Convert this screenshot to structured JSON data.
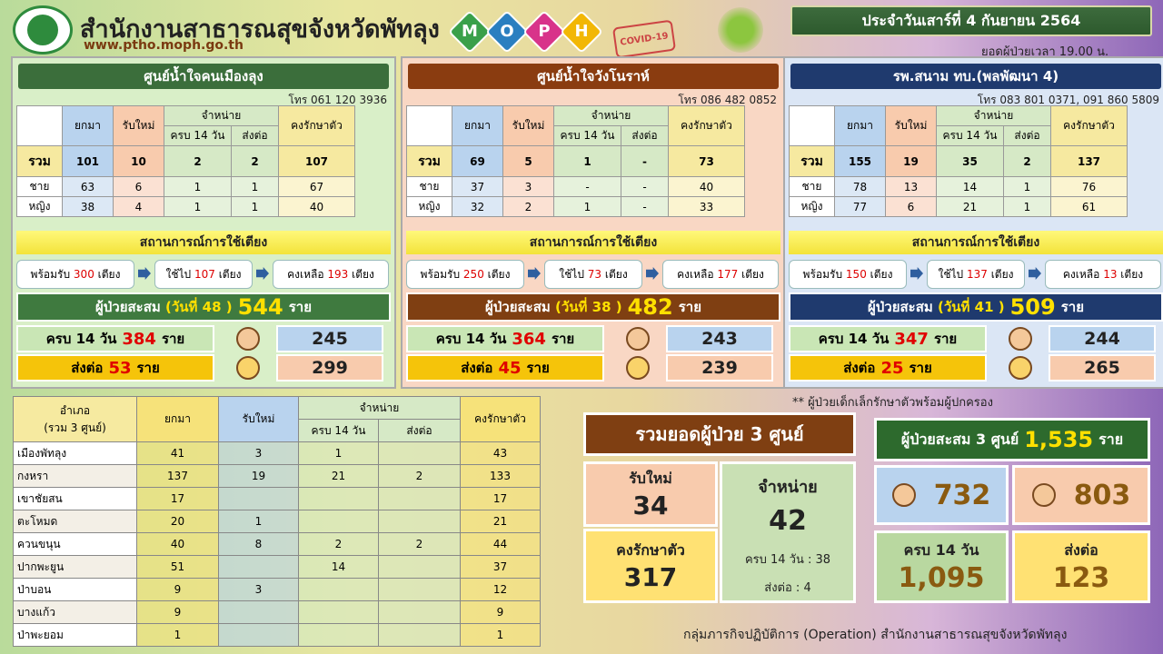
{
  "header": {
    "org": "สำนักงานสาธารณสุขจังหวัดพัทลุง",
    "web": "www.ptho.moph.go.th",
    "moph": [
      "M",
      "O",
      "P",
      "H"
    ],
    "covid_stamp": "COVID-19",
    "date": "ประจำวันเสาร์ที่ 4 กันยายน 2564",
    "as_of": "ยอดผู้ป่วยเวลา 19.00 น."
  },
  "cols": {
    "carry": "ยกมา",
    "new": "รับใหม่",
    "discharge": "จำหน่าย",
    "full14": "ครบ 14 วัน",
    "refer": "ส่งต่อ",
    "remain": "คงรักษาตัว",
    "total": "รวม",
    "male": "ชาย",
    "female": "หญิง"
  },
  "bed_title": "สถานการณ์การใช้เตียง",
  "centers": [
    {
      "title": "ศูนย์น้ำใจคนเมืองลุง",
      "phone": "โทร 061 120 3936",
      "total": [
        "101",
        "10",
        "2",
        "2",
        "107"
      ],
      "male": [
        "63",
        "6",
        "1",
        "1",
        "67"
      ],
      "female": [
        "38",
        "4",
        "1",
        "1",
        "40"
      ],
      "beds": [
        "พร้อมรับ",
        "300",
        "เตียง",
        "ใช้ไป",
        "107",
        "เตียง",
        "คงเหลือ",
        "193",
        "เตียง"
      ],
      "cum_label": "ผู้ป่วยสะสม",
      "cum_day": "(วันที่ 48 )",
      "cum_n": "544",
      "unit": "ราย",
      "full14": "384",
      "refer": "53",
      "boys": "245",
      "girls": "299"
    },
    {
      "title": "ศูนย์น้ำใจวังโนราห์",
      "phone": "โทร 086 482 0852",
      "total": [
        "69",
        "5",
        "1",
        "-",
        "73"
      ],
      "male": [
        "37",
        "3",
        "-",
        "-",
        "40"
      ],
      "female": [
        "32",
        "2",
        "1",
        "-",
        "33"
      ],
      "beds": [
        "พร้อมรับ",
        "250",
        "เตียง",
        "ใช้ไป",
        "73",
        "เตียง",
        "คงเหลือ",
        "177",
        "เตียง"
      ],
      "cum_label": "ผู้ป่วยสะสม",
      "cum_day": "(วันที่ 38 )",
      "cum_n": "482",
      "unit": "ราย",
      "full14": "364",
      "refer": "45",
      "boys": "243",
      "girls": "239"
    },
    {
      "title": "รพ.สนาม ทบ.(พลพัฒนา 4)",
      "phone": "โทร 083 801 0371, 091 860 5809",
      "total": [
        "155",
        "19",
        "35",
        "2",
        "137"
      ],
      "male": [
        "78",
        "13",
        "14",
        "1",
        "76"
      ],
      "female": [
        "77",
        "6",
        "21",
        "1",
        "61"
      ],
      "beds": [
        "พร้อมรับ",
        "150",
        "เตียง",
        "ใช้ไป",
        "137",
        "เตียง",
        "คงเหลือ",
        "13",
        "เตียง"
      ],
      "cum_label": "ผู้ป่วยสะสม",
      "cum_day": "(วันที่ 41 )",
      "cum_n": "509",
      "unit": "ราย",
      "full14": "347",
      "refer": "25",
      "boys": "244",
      "girls": "265"
    }
  ],
  "sub_labels": {
    "full14": "ครบ 14 วัน",
    "refer": "ส่งต่อ",
    "unit": "ราย"
  },
  "note": "** ผู้ป่วยเด็กเล็กรักษาตัวพร้อมผู้ปกครอง",
  "district": {
    "h1": "อำเภอ",
    "h2": "(รวม 3 ศูนย์)",
    "rows": [
      [
        "เมืองพัทลุง",
        "41",
        "3",
        "1",
        "",
        "43"
      ],
      [
        "กงหรา",
        "137",
        "19",
        "21",
        "2",
        "133"
      ],
      [
        "เขาชัยสน",
        "17",
        "",
        "",
        "",
        "17"
      ],
      [
        "ตะโหมด",
        "20",
        "1",
        "",
        "",
        "21"
      ],
      [
        "ควนขนุน",
        "40",
        "8",
        "2",
        "2",
        "44"
      ],
      [
        "ปากพะยูน",
        "51",
        "",
        "14",
        "",
        "37"
      ],
      [
        "ป่าบอน",
        "9",
        "3",
        "",
        "",
        "12"
      ],
      [
        "บางแก้ว",
        "9",
        "",
        "",
        "",
        "9"
      ],
      [
        "ป่าพะยอม",
        "1",
        "",
        "",
        "",
        "1"
      ]
    ]
  },
  "summary": {
    "title": "รวมยอดผู้ป่วย 3 ศูนย์",
    "new_label": "รับใหม่",
    "new": "34",
    "dis_label": "จำหน่าย",
    "dis": "42",
    "remain_label": "คงรักษาตัว",
    "remain": "317",
    "dis_full": "ครบ 14 วัน  : 38",
    "dis_refer": "ส่งต่อ : 4",
    "cum_label": "ผู้ป่วยสะสม 3 ศูนย์",
    "cum": "1,535",
    "cum_unit": "ราย",
    "boys": "732",
    "girls": "803",
    "full14_label": "ครบ 14 วัน",
    "full14": "1,095",
    "refer_label": "ส่งต่อ",
    "refer": "123"
  },
  "footer": "กลุ่มภารกิจปฏิบัติการ (Operation) สำนักงานสาธารณสุขจังหวัดพัทลุง"
}
